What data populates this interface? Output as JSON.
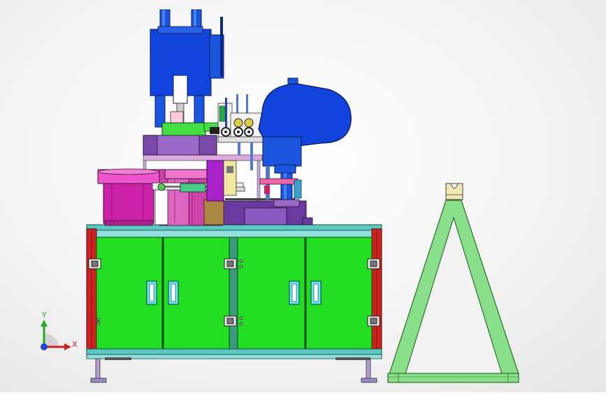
{
  "axis_triad": {
    "x_label": "X",
    "y_label": "Y"
  },
  "colors": {
    "cabinet_green": "#22dd22",
    "frame_teal": "#5cc8c0",
    "side_red": "#cc2222",
    "press_blue": "#1144dd",
    "feeder_magenta": "#cc22aa",
    "stand_green": "#88e088",
    "cylinder_purple": "#6622aa"
  }
}
